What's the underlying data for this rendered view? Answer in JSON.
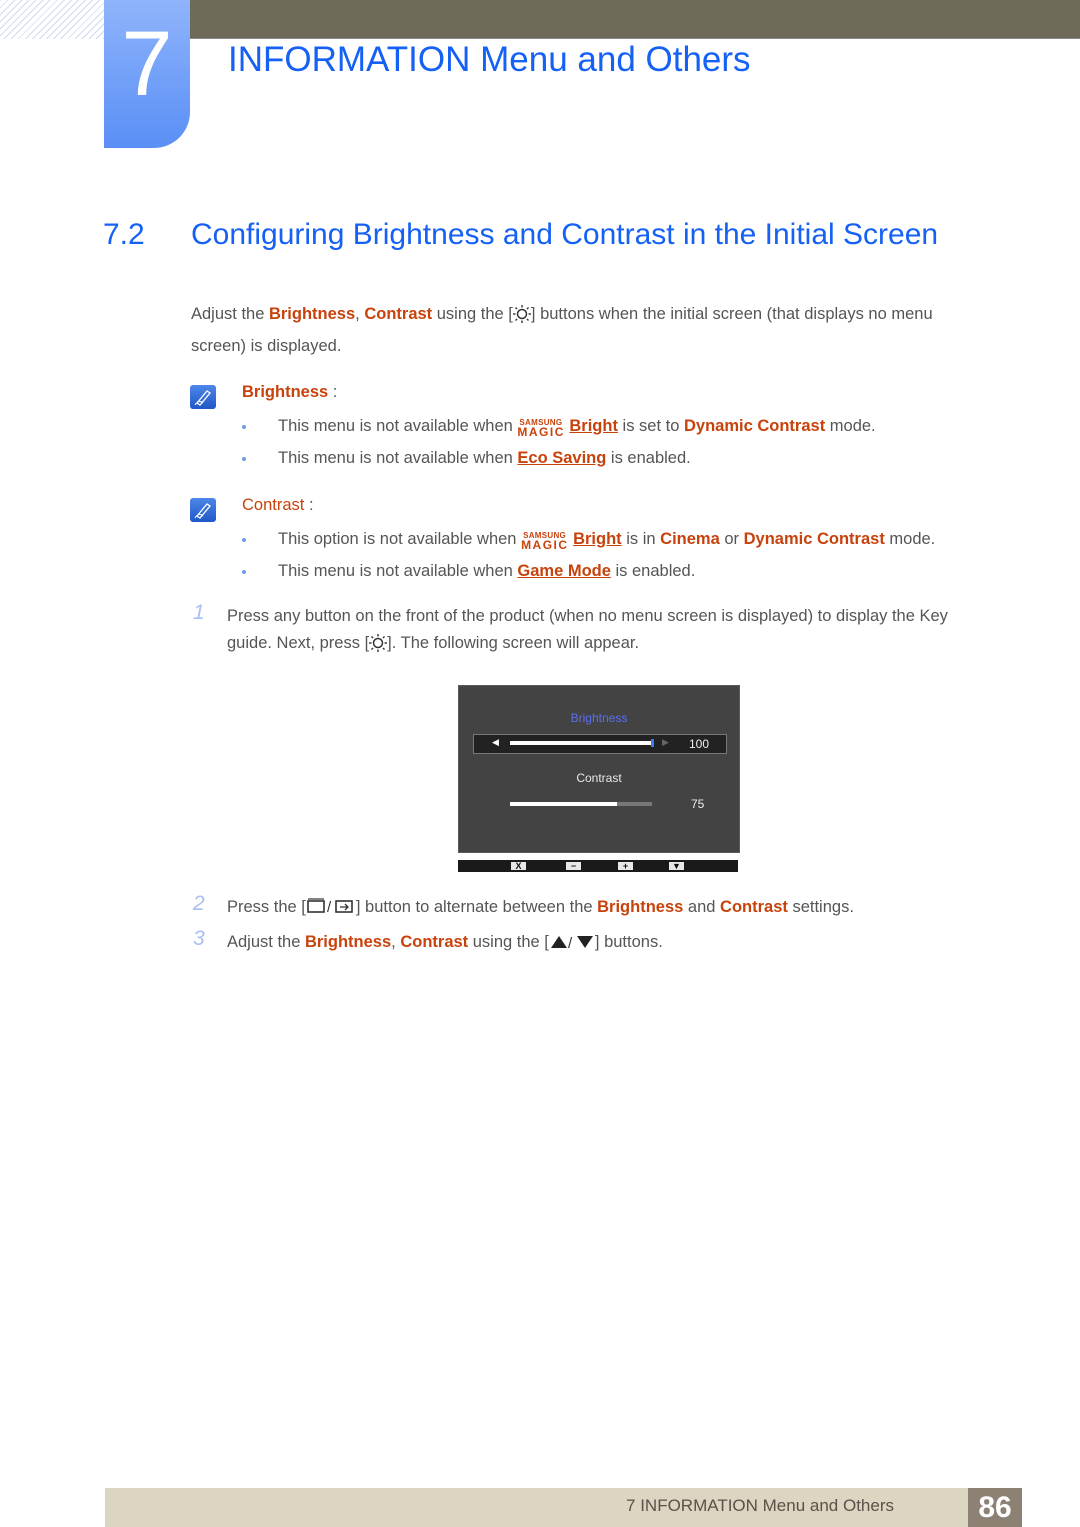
{
  "header": {
    "chapter_number": "7",
    "chapter_title": "INFORMATION Menu and Others"
  },
  "section": {
    "number": "7.2",
    "title": "Configuring Brightness and Contrast in the Initial Screen"
  },
  "intro": {
    "t1": "Adjust the ",
    "brightness": "Brightness",
    "comma": ", ",
    "contrast": "Contrast",
    "t2": " using the [",
    "button_icon": "sun-icon",
    "t3": "] buttons when the initial screen (that displays no menu",
    "line2": "screen) is displayed."
  },
  "notes": [
    {
      "heading": "Brightness",
      "colon": " :",
      "bullets": [
        {
          "t1": "This menu is not available when ",
          "magic_small": "SAMSUNG",
          "magic_big": "MAGIC",
          "link": "Bright",
          "t2": " is set to ",
          "hl": "Dynamic Contrast",
          "t3": " mode."
        },
        {
          "t1": "This menu is not available when ",
          "link": "Eco Saving",
          "t2": " is enabled."
        }
      ]
    },
    {
      "heading": "Contrast",
      "colon": " :",
      "bullets": [
        {
          "t1": "This option is not available when ",
          "magic_small": "SAMSUNG",
          "magic_big": "MAGIC",
          "link": "Bright",
          "t2": " is in ",
          "hl1": "Cinema",
          "t3": " or ",
          "hl2": "Dynamic Contrast",
          "t4": " mode."
        },
        {
          "t1": "This menu is not available when ",
          "link": "Game Mode",
          "t2": " is enabled."
        }
      ]
    }
  ],
  "steps": [
    {
      "number": "1",
      "line1": "Press any button on the front of the product (when no menu screen is displayed) to display the Key",
      "line2a": "guide. Next, press [",
      "line2b": "]. The following screen will appear."
    },
    {
      "number": "2",
      "t1": "Press the [",
      "t2": "] button to alternate between the ",
      "hl1": "Brightness",
      "t3": " and ",
      "hl2": "Contrast",
      "t4": " settings."
    },
    {
      "number": "3",
      "t1": "Adjust the ",
      "hl1": "Brightness",
      "comma": ", ",
      "hl2": "Contrast",
      "t2": " using the [",
      "t3": "] buttons."
    }
  ],
  "osd": {
    "brightness_label": "Brightness",
    "brightness_value": "100",
    "brightness_level": 1.0,
    "contrast_label": "Contrast",
    "contrast_value": "75",
    "contrast_level": 0.75,
    "keys": [
      "X",
      "−",
      "+",
      "▼"
    ],
    "colors": {
      "selected_label": "#5b6ef0",
      "panel": "#434343"
    }
  },
  "footer": {
    "text": "7 INFORMATION Menu and Others",
    "page_number": "86"
  },
  "colors": {
    "accent_blue": "#1560f5",
    "highlight": "#c8420c",
    "topbar": "#6d6a57",
    "footer": "#dcd5c2",
    "page_tab": "#8d8174"
  }
}
